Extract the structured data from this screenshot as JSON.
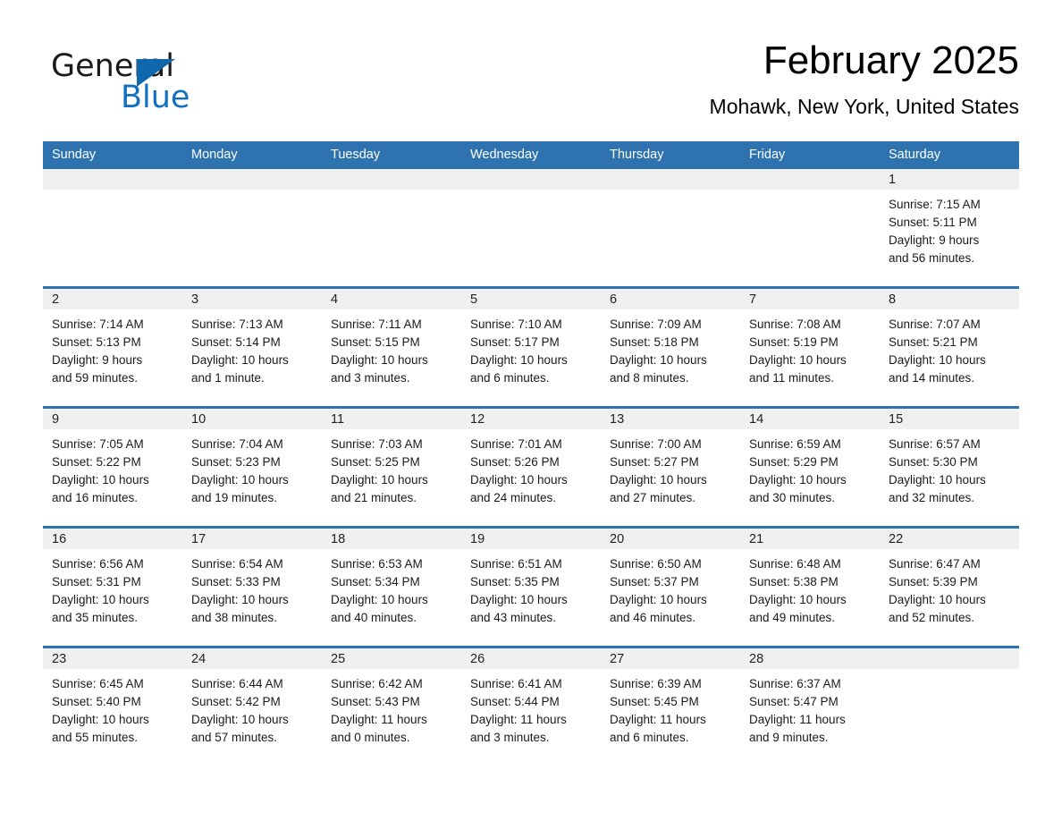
{
  "brand": {
    "word_one": "General",
    "word_two": "Blue",
    "triangle_color": "#1067ac",
    "blue_color": "#1170bf"
  },
  "header": {
    "month_title": "February 2025",
    "location": "Mohawk, New York, United States"
  },
  "theme": {
    "header_blue": "#2e73b0",
    "row_divider_blue": "#2e73b0",
    "daynum_band": "#f0f0f0",
    "cell_background": "#ffffff",
    "text": "#1a1a1a"
  },
  "calendar": {
    "weekday_headers": [
      "Sunday",
      "Monday",
      "Tuesday",
      "Wednesday",
      "Thursday",
      "Friday",
      "Saturday"
    ],
    "weeks": [
      [
        {
          "empty": true
        },
        {
          "empty": true
        },
        {
          "empty": true
        },
        {
          "empty": true
        },
        {
          "empty": true
        },
        {
          "empty": true
        },
        {
          "day": "1",
          "sunrise": "Sunrise: 7:15 AM",
          "sunset": "Sunset: 5:11 PM",
          "daylight_1": "Daylight: 9 hours",
          "daylight_2": "and 56 minutes."
        }
      ],
      [
        {
          "day": "2",
          "sunrise": "Sunrise: 7:14 AM",
          "sunset": "Sunset: 5:13 PM",
          "daylight_1": "Daylight: 9 hours",
          "daylight_2": "and 59 minutes."
        },
        {
          "day": "3",
          "sunrise": "Sunrise: 7:13 AM",
          "sunset": "Sunset: 5:14 PM",
          "daylight_1": "Daylight: 10 hours",
          "daylight_2": "and 1 minute."
        },
        {
          "day": "4",
          "sunrise": "Sunrise: 7:11 AM",
          "sunset": "Sunset: 5:15 PM",
          "daylight_1": "Daylight: 10 hours",
          "daylight_2": "and 3 minutes."
        },
        {
          "day": "5",
          "sunrise": "Sunrise: 7:10 AM",
          "sunset": "Sunset: 5:17 PM",
          "daylight_1": "Daylight: 10 hours",
          "daylight_2": "and 6 minutes."
        },
        {
          "day": "6",
          "sunrise": "Sunrise: 7:09 AM",
          "sunset": "Sunset: 5:18 PM",
          "daylight_1": "Daylight: 10 hours",
          "daylight_2": "and 8 minutes."
        },
        {
          "day": "7",
          "sunrise": "Sunrise: 7:08 AM",
          "sunset": "Sunset: 5:19 PM",
          "daylight_1": "Daylight: 10 hours",
          "daylight_2": "and 11 minutes."
        },
        {
          "day": "8",
          "sunrise": "Sunrise: 7:07 AM",
          "sunset": "Sunset: 5:21 PM",
          "daylight_1": "Daylight: 10 hours",
          "daylight_2": "and 14 minutes."
        }
      ],
      [
        {
          "day": "9",
          "sunrise": "Sunrise: 7:05 AM",
          "sunset": "Sunset: 5:22 PM",
          "daylight_1": "Daylight: 10 hours",
          "daylight_2": "and 16 minutes."
        },
        {
          "day": "10",
          "sunrise": "Sunrise: 7:04 AM",
          "sunset": "Sunset: 5:23 PM",
          "daylight_1": "Daylight: 10 hours",
          "daylight_2": "and 19 minutes."
        },
        {
          "day": "11",
          "sunrise": "Sunrise: 7:03 AM",
          "sunset": "Sunset: 5:25 PM",
          "daylight_1": "Daylight: 10 hours",
          "daylight_2": "and 21 minutes."
        },
        {
          "day": "12",
          "sunrise": "Sunrise: 7:01 AM",
          "sunset": "Sunset: 5:26 PM",
          "daylight_1": "Daylight: 10 hours",
          "daylight_2": "and 24 minutes."
        },
        {
          "day": "13",
          "sunrise": "Sunrise: 7:00 AM",
          "sunset": "Sunset: 5:27 PM",
          "daylight_1": "Daylight: 10 hours",
          "daylight_2": "and 27 minutes."
        },
        {
          "day": "14",
          "sunrise": "Sunrise: 6:59 AM",
          "sunset": "Sunset: 5:29 PM",
          "daylight_1": "Daylight: 10 hours",
          "daylight_2": "and 30 minutes."
        },
        {
          "day": "15",
          "sunrise": "Sunrise: 6:57 AM",
          "sunset": "Sunset: 5:30 PM",
          "daylight_1": "Daylight: 10 hours",
          "daylight_2": "and 32 minutes."
        }
      ],
      [
        {
          "day": "16",
          "sunrise": "Sunrise: 6:56 AM",
          "sunset": "Sunset: 5:31 PM",
          "daylight_1": "Daylight: 10 hours",
          "daylight_2": "and 35 minutes."
        },
        {
          "day": "17",
          "sunrise": "Sunrise: 6:54 AM",
          "sunset": "Sunset: 5:33 PM",
          "daylight_1": "Daylight: 10 hours",
          "daylight_2": "and 38 minutes."
        },
        {
          "day": "18",
          "sunrise": "Sunrise: 6:53 AM",
          "sunset": "Sunset: 5:34 PM",
          "daylight_1": "Daylight: 10 hours",
          "daylight_2": "and 40 minutes."
        },
        {
          "day": "19",
          "sunrise": "Sunrise: 6:51 AM",
          "sunset": "Sunset: 5:35 PM",
          "daylight_1": "Daylight: 10 hours",
          "daylight_2": "and 43 minutes."
        },
        {
          "day": "20",
          "sunrise": "Sunrise: 6:50 AM",
          "sunset": "Sunset: 5:37 PM",
          "daylight_1": "Daylight: 10 hours",
          "daylight_2": "and 46 minutes."
        },
        {
          "day": "21",
          "sunrise": "Sunrise: 6:48 AM",
          "sunset": "Sunset: 5:38 PM",
          "daylight_1": "Daylight: 10 hours",
          "daylight_2": "and 49 minutes."
        },
        {
          "day": "22",
          "sunrise": "Sunrise: 6:47 AM",
          "sunset": "Sunset: 5:39 PM",
          "daylight_1": "Daylight: 10 hours",
          "daylight_2": "and 52 minutes."
        }
      ],
      [
        {
          "day": "23",
          "sunrise": "Sunrise: 6:45 AM",
          "sunset": "Sunset: 5:40 PM",
          "daylight_1": "Daylight: 10 hours",
          "daylight_2": "and 55 minutes."
        },
        {
          "day": "24",
          "sunrise": "Sunrise: 6:44 AM",
          "sunset": "Sunset: 5:42 PM",
          "daylight_1": "Daylight: 10 hours",
          "daylight_2": "and 57 minutes."
        },
        {
          "day": "25",
          "sunrise": "Sunrise: 6:42 AM",
          "sunset": "Sunset: 5:43 PM",
          "daylight_1": "Daylight: 11 hours",
          "daylight_2": "and 0 minutes."
        },
        {
          "day": "26",
          "sunrise": "Sunrise: 6:41 AM",
          "sunset": "Sunset: 5:44 PM",
          "daylight_1": "Daylight: 11 hours",
          "daylight_2": "and 3 minutes."
        },
        {
          "day": "27",
          "sunrise": "Sunrise: 6:39 AM",
          "sunset": "Sunset: 5:45 PM",
          "daylight_1": "Daylight: 11 hours",
          "daylight_2": "and 6 minutes."
        },
        {
          "day": "28",
          "sunrise": "Sunrise: 6:37 AM",
          "sunset": "Sunset: 5:47 PM",
          "daylight_1": "Daylight: 11 hours",
          "daylight_2": "and 9 minutes."
        },
        {
          "empty": true
        }
      ]
    ]
  }
}
